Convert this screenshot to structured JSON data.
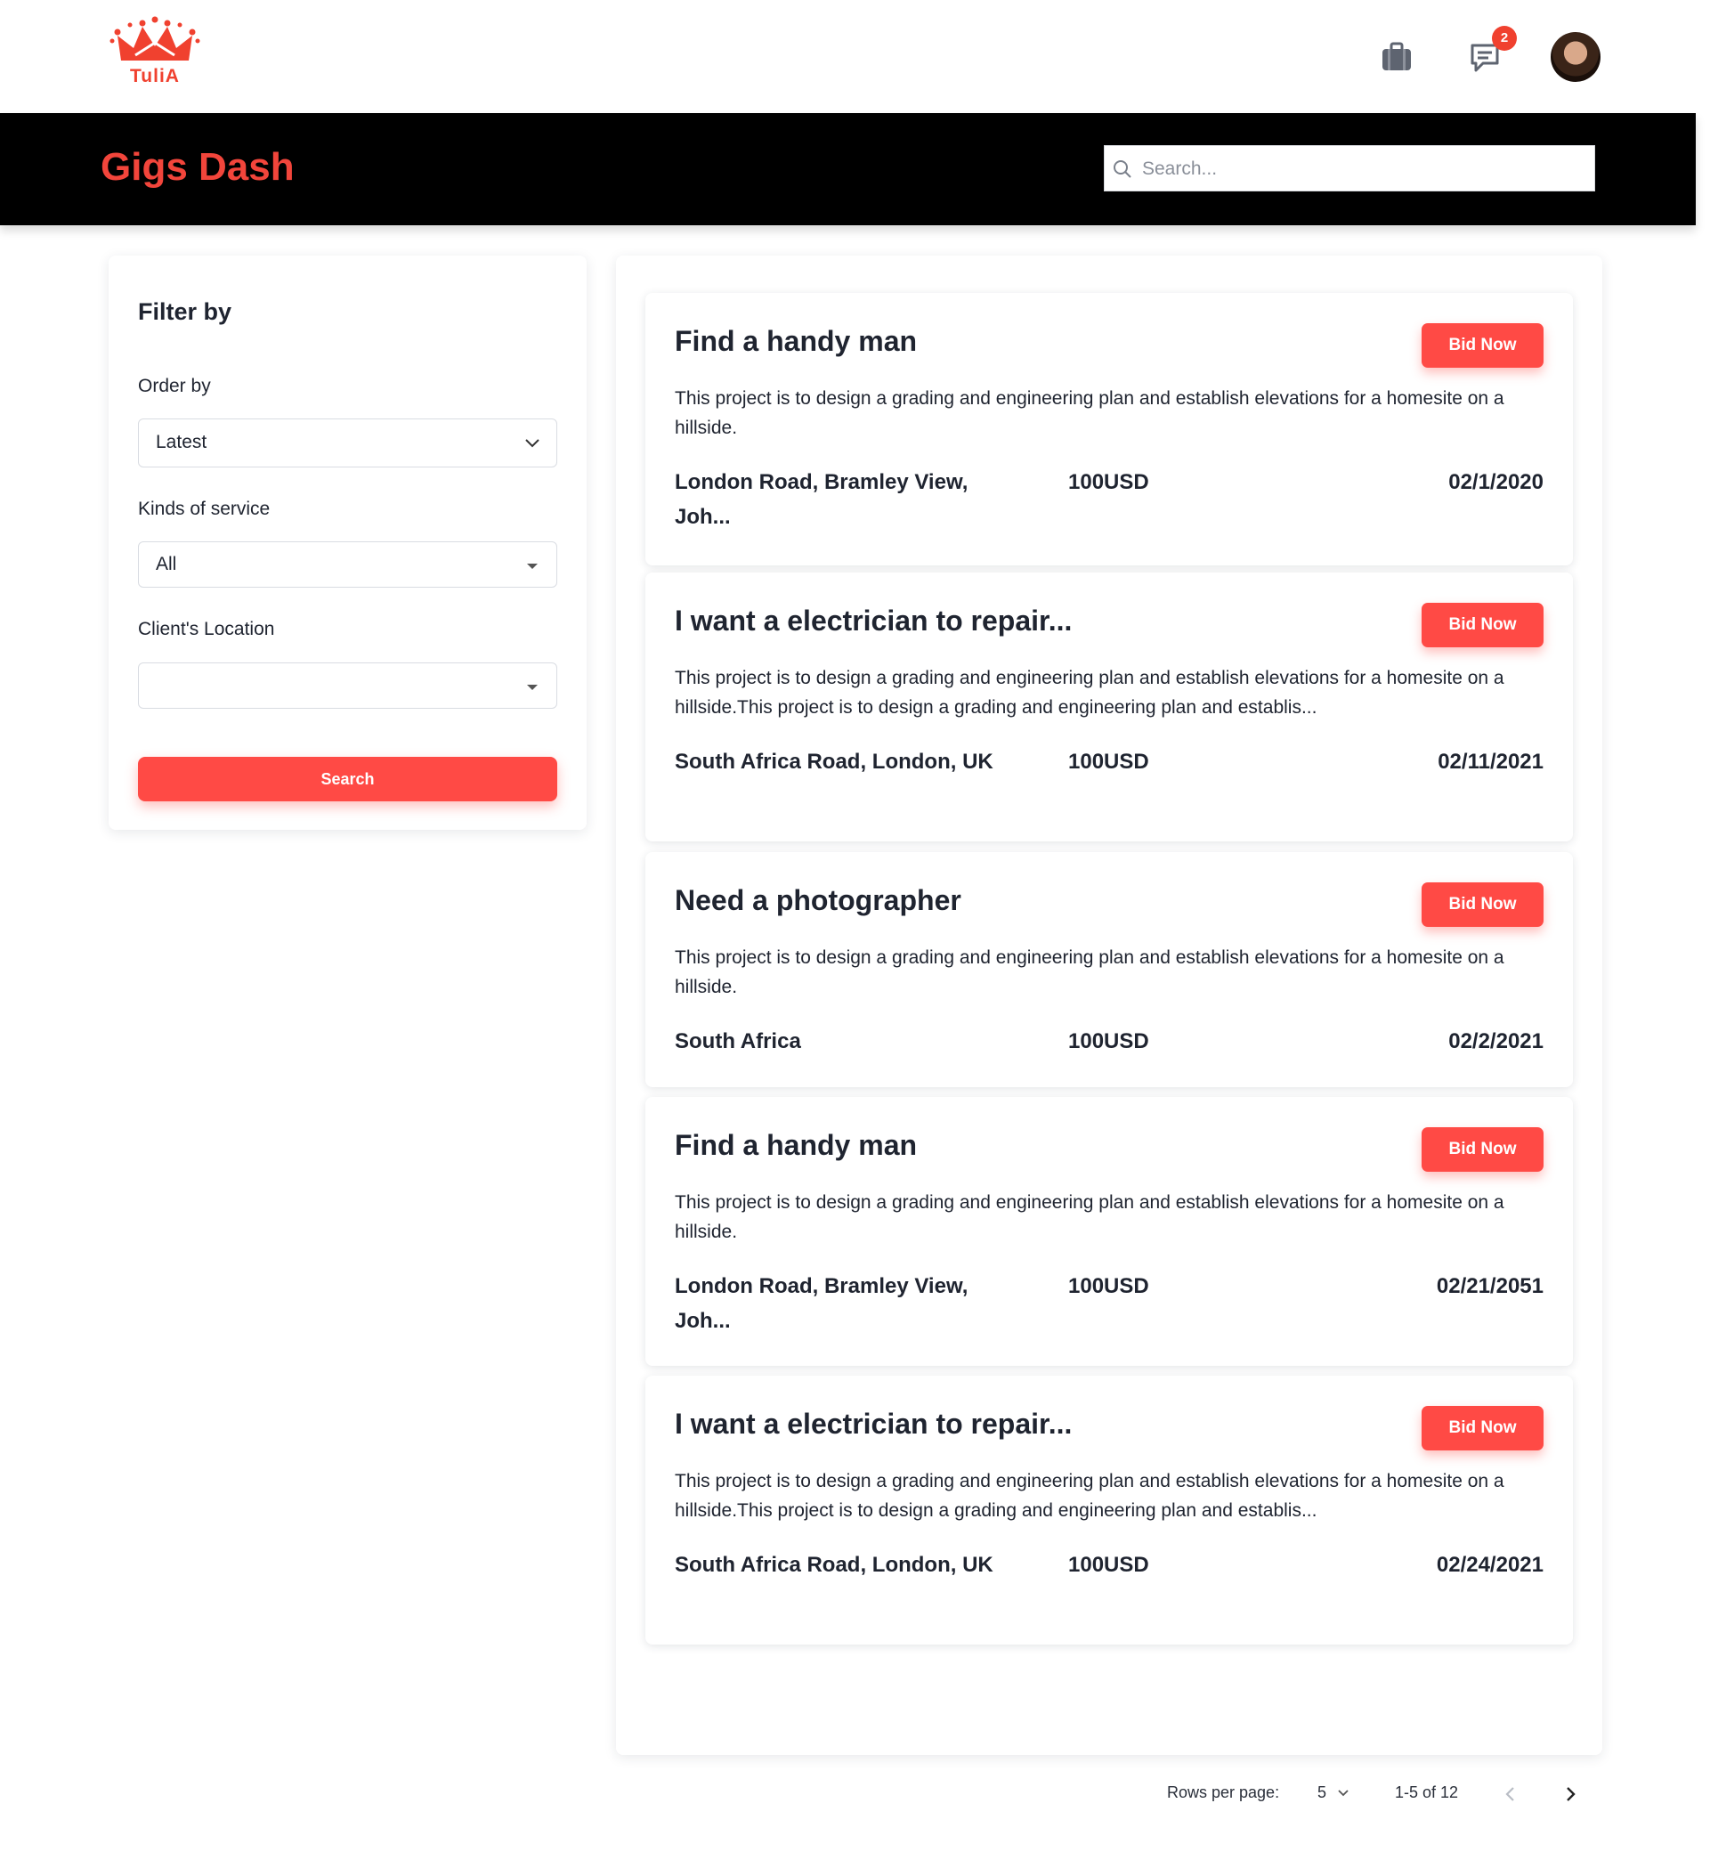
{
  "brand": {
    "logo_text": "TuliA",
    "accent": "#f0412f"
  },
  "topnav": {
    "icons": [
      "briefcase-icon",
      "chat-icon"
    ],
    "notification_count": "2"
  },
  "header": {
    "title": "Gigs Dash",
    "search_placeholder": "Search..."
  },
  "filter": {
    "heading": "Filter by",
    "order_label": "Order by",
    "order_value": "Latest",
    "service_label": "Kinds of service",
    "service_value": "All",
    "location_label": "Client's Location",
    "location_value": "",
    "search_button": "Search"
  },
  "gigs": [
    {
      "title": "Find a handy man",
      "bid_label": "Bid Now",
      "description": "This project is to design a grading and engineering plan and establish elevations for a homesite on a hillside.",
      "location": "London Road, Bramley View, Joh...",
      "price": "100USD",
      "date": "02/1/2020"
    },
    {
      "title": "I want a electrician to repair...",
      "bid_label": "Bid Now",
      "description": "This project is to design a grading and engineering plan and establish elevations for a homesite on a hillside.This project is to design a grading and engineering plan and establis...",
      "location": "South Africa Road, London, UK",
      "price": "100USD",
      "date": "02/11/2021"
    },
    {
      "title": "Need a photographer",
      "bid_label": "Bid Now",
      "description": "This project is to design a grading and engineering plan and establish elevations for a homesite on a hillside.",
      "location": "South Africa",
      "price": "100USD",
      "date": "02/2/2021"
    },
    {
      "title": "Find a handy man",
      "bid_label": "Bid Now",
      "description": "This project is to design a grading and engineering plan and establish elevations for a homesite on a hillside.",
      "location": "London Road, Bramley View, Joh...",
      "price": "100USD",
      "date": "02/21/2051"
    },
    {
      "title": "I want a electrician to repair...",
      "bid_label": "Bid Now",
      "description": "This project is to design a grading and engineering plan and establish elevations for a homesite on a hillside.This project is to design a grading and engineering plan and establis...",
      "location": "South Africa Road, London, UK",
      "price": "100USD",
      "date": "02/24/2021"
    }
  ],
  "pagination": {
    "rows_label": "Rows per page:",
    "rows_value": "5",
    "range": "1-5 of 12"
  }
}
